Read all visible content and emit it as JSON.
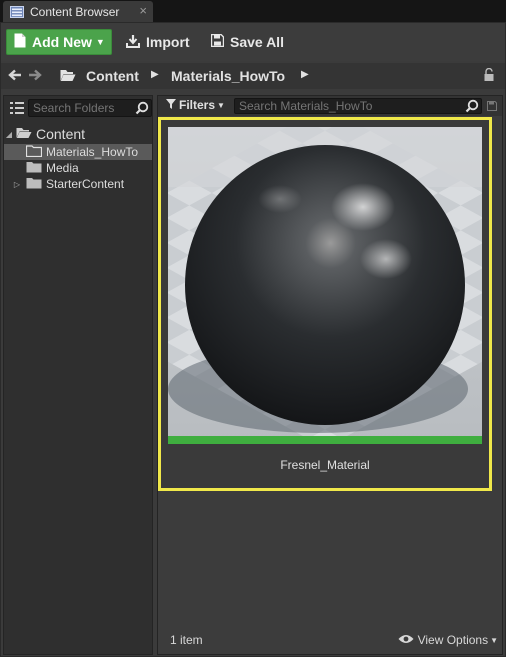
{
  "tab": {
    "title": "Content Browser",
    "close": "×"
  },
  "toolbar": {
    "add_new": "Add New",
    "import": "Import",
    "save_all": "Save All"
  },
  "path": {
    "root": "Content",
    "current": "Materials_HowTo"
  },
  "sources": {
    "search_placeholder": "Search Folders",
    "tree": [
      {
        "label": "Content",
        "expanded": true
      },
      {
        "label": "Materials_HowTo",
        "selected": true
      },
      {
        "label": "Media"
      },
      {
        "label": "StarterContent",
        "collapsed": true
      }
    ]
  },
  "assets": {
    "filters_label": "Filters",
    "search_placeholder": "Search Materials_HowTo",
    "items": [
      {
        "name": "Fresnel_Material"
      }
    ],
    "item_count": "1 item",
    "view_options": "View Options"
  },
  "colors": {
    "add_new_green": "#4ba34b",
    "selection_highlight": "#f0e84a",
    "material_bar": "#3fae3f"
  }
}
